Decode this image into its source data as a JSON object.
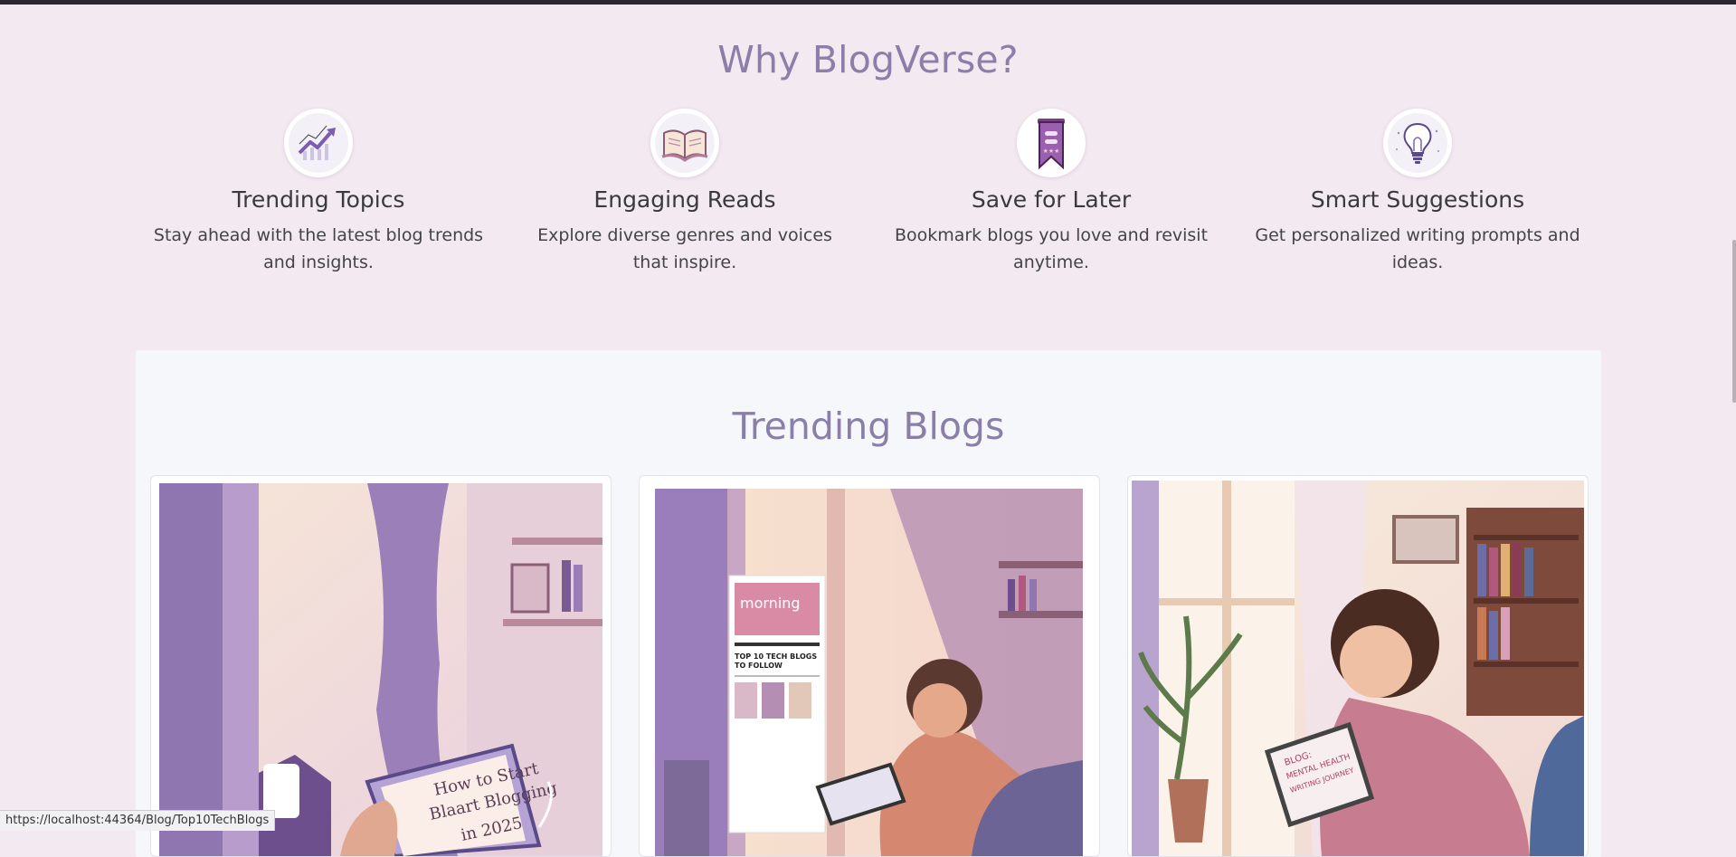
{
  "why": {
    "title": "Why BlogVerse?",
    "features": [
      {
        "icon": "trending-chart-icon",
        "title": "Trending Topics",
        "text": "Stay ahead with the latest blog trends and insights."
      },
      {
        "icon": "open-book-icon",
        "title": "Engaging Reads",
        "text": "Explore diverse genres and voices that inspire."
      },
      {
        "icon": "bookmark-ribbon-icon",
        "title": "Save for Later",
        "text": "Bookmark blogs you love and revisit anytime."
      },
      {
        "icon": "lightbulb-icon",
        "title": "Smart Suggestions",
        "text": "Get personalized writing prompts and ideas."
      }
    ]
  },
  "trending": {
    "title": "Trending Blogs",
    "cards": [
      {
        "image_text_line1": "How to Start",
        "image_text_line2": "Blaart Blogging",
        "image_text_line3": "in 2025"
      },
      {
        "image_text_line1": "morning",
        "image_text_line2": "TOP 10 TECH BLOGS",
        "image_text_line3": "TO FOLLOW"
      },
      {
        "image_text_line1": "BLOG:",
        "image_text_line2": "MENTAL HEALTH",
        "image_text_line3": "WRITING JOURNEY"
      }
    ]
  },
  "status": {
    "url": "https://localhost:44364/Blog/Top10TechBlogs"
  },
  "colors": {
    "accent": "#8b7fa9",
    "background": "#f3e9f1",
    "panel": "#f6f7fa"
  }
}
